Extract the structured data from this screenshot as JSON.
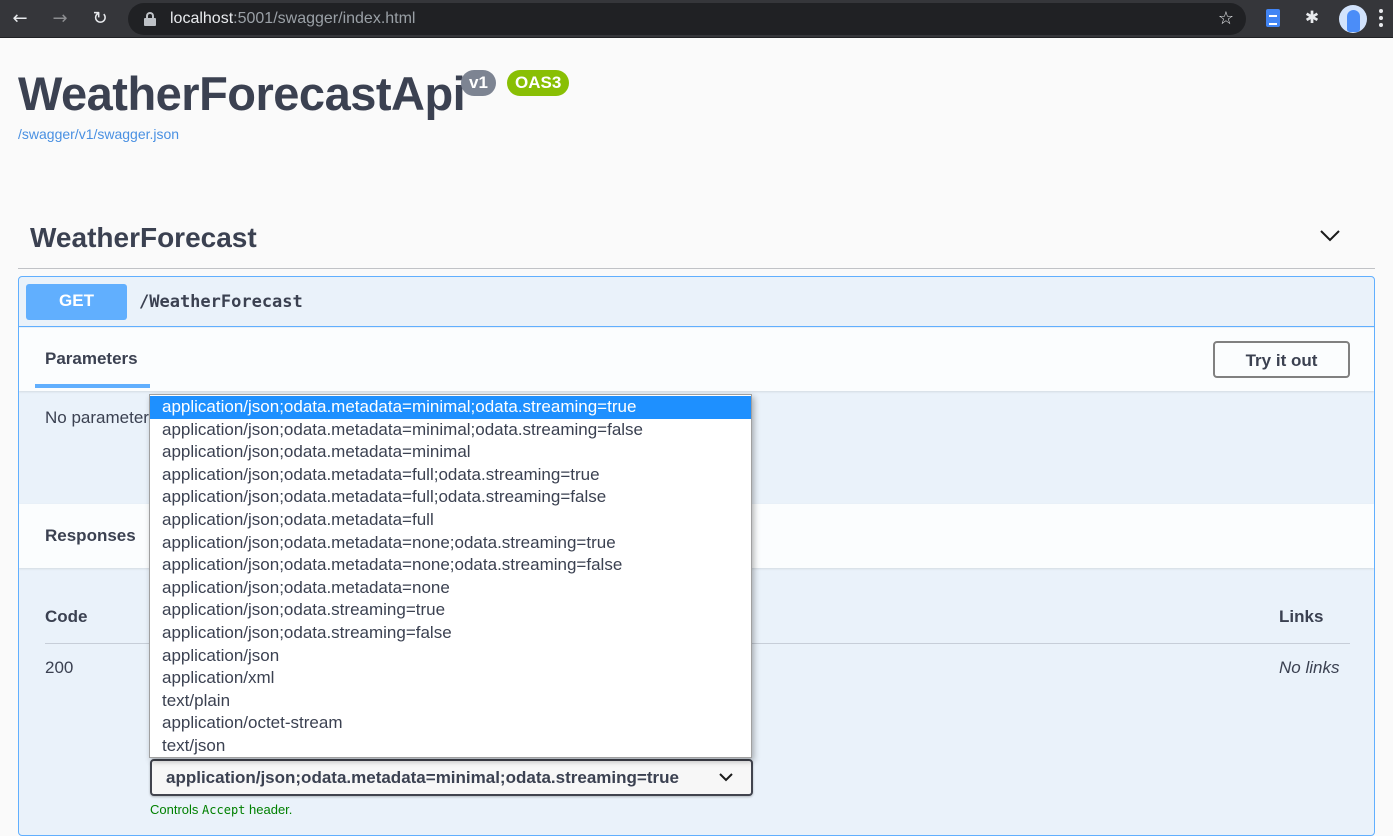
{
  "browser": {
    "url_host": "localhost",
    "url_rest": ":5001/swagger/index.html",
    "back_glyph": "←",
    "forward_glyph": "→",
    "reload_glyph": "↻",
    "star_glyph": "☆",
    "puzzle_glyph": "✱"
  },
  "info": {
    "title": "WeatherForecastApi",
    "version_badge": "v1",
    "spec_badge": "OAS3",
    "spec_link": "/swagger/v1/swagger.json"
  },
  "tag": {
    "name": "WeatherForecast"
  },
  "operation": {
    "method": "GET",
    "path": "/WeatherForecast",
    "parameters_label": "Parameters",
    "try_it_out_label": "Try it out",
    "no_parameters_text": "No parameters",
    "responses_label": "Responses",
    "columns": {
      "code": "Code",
      "links": "Links"
    },
    "responses": [
      {
        "code": "200",
        "links": "No links"
      }
    ],
    "content_type": {
      "selected": "application/json;odata.metadata=minimal;odata.streaming=true",
      "options": [
        "application/json;odata.metadata=minimal;odata.streaming=true",
        "application/json;odata.metadata=minimal;odata.streaming=false",
        "application/json;odata.metadata=minimal",
        "application/json;odata.metadata=full;odata.streaming=true",
        "application/json;odata.metadata=full;odata.streaming=false",
        "application/json;odata.metadata=full",
        "application/json;odata.metadata=none;odata.streaming=true",
        "application/json;odata.metadata=none;odata.streaming=false",
        "application/json;odata.metadata=none",
        "application/json;odata.streaming=true",
        "application/json;odata.streaming=false",
        "application/json",
        "application/xml",
        "text/plain",
        "application/octet-stream",
        "text/json"
      ],
      "controls_prefix": "Controls",
      "controls_code": "Accept",
      "controls_suffix": "header."
    }
  },
  "colors": {
    "get_accent": "#61affe",
    "badge_version": "#7d8492",
    "badge_oas": "#89bf04",
    "link": "#4990e2",
    "selection": "#1e90ff"
  }
}
